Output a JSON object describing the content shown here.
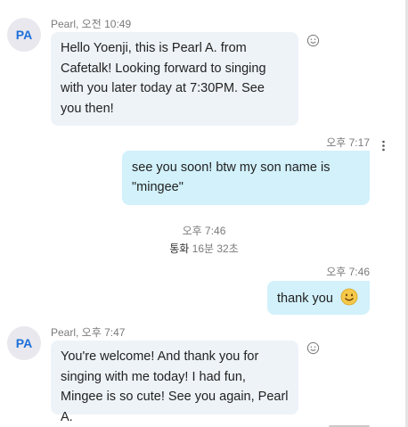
{
  "messages": [
    {
      "sender": "Pearl",
      "avatar_initials": "PA",
      "header": "Pearl, 오전 10:49",
      "text": "Hello Yoenji, this is Pearl A. from Cafetalk!  Looking forward to singing with you later today at 7:30PM.  See you then!"
    },
    {
      "time": "오후 7:17",
      "text": "see you soon! btw my son name is \"mingee\""
    },
    {
      "call_time": "오후 7:46",
      "call_label": "통화",
      "call_duration": "16분 32초"
    },
    {
      "time": "오후 7:46",
      "text": "thank you"
    },
    {
      "sender": "Pearl",
      "avatar_initials": "PA",
      "header": "Pearl, 오후 7:47",
      "text": "You're welcome!  And thank you for singing with me today!  I had fun, Mingee is so cute!  See you again,  Pearl A."
    }
  ],
  "colors": {
    "incoming_bubble": "#eef3f8",
    "outgoing_bubble": "#d2f1fb",
    "avatar_bg": "#e8e8ee",
    "avatar_text": "#1e6fd9",
    "emoji": "#f5c84a"
  },
  "icons": {
    "reaction": "smiley-outline-icon",
    "more": "vertical-dots-icon",
    "emoji": "smiling-face-emoji"
  }
}
